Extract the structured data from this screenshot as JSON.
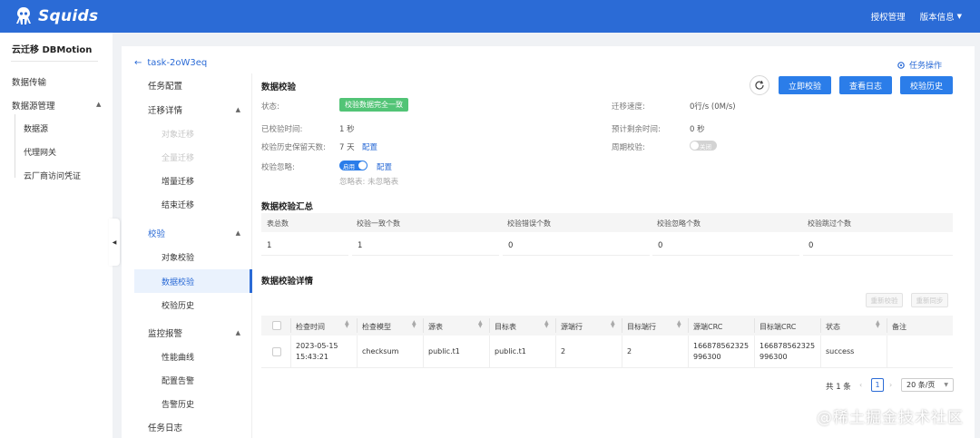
{
  "brand": {
    "name": "Squids",
    "primary": "#2b6bd6"
  },
  "topbar": {
    "links": [
      "授权管理",
      "版本信息"
    ]
  },
  "leftnav": {
    "title": "云迁移 DBMotion",
    "items": [
      "数据传输",
      "数据源管理"
    ],
    "subitems": [
      "数据源",
      "代理网关",
      "云厂商访问凭证"
    ]
  },
  "task": {
    "name": "task-2oW3eq",
    "ops_label": "任务操作"
  },
  "tree": {
    "task_config": "任务配置",
    "migration_details": "迁移详情",
    "object_migration": "对象迁移",
    "full_migration": "全量迁移",
    "incremental_migration": "增量迁移",
    "end_migration": "结束迁移",
    "verify": "校验",
    "object_verify": "对象校验",
    "data_verify": "数据校验",
    "verify_history": "校验历史",
    "monitor_alert": "监控报警",
    "perf_curve": "性能曲线",
    "config_alert": "配置告警",
    "alert_history": "告警历史",
    "task_log": "任务日志"
  },
  "section": {
    "title": "数据校验",
    "buttons": {
      "verify_now": "立即校验",
      "view_logs": "查看日志",
      "verify_history": "校验历史"
    }
  },
  "info": {
    "status_label": "状态:",
    "status_value": "校验数据完全一致",
    "verified_time_label": "已校验时间:",
    "verified_time_value": "1 秒",
    "retention_label": "校验历史保留天数:",
    "retention_value": "7 天",
    "retention_link": "配置",
    "ignore_label": "校验忽略:",
    "ignore_toggle": "启用",
    "ignore_link": "配置",
    "ignore_tables": "忽略表: 未忽略表",
    "speed_label": "迁移速度:",
    "speed_value": "0行/s (0M/s)",
    "remaining_label": "预计剩余时间:",
    "remaining_value": "0 秒",
    "periodic_label": "周期校验:",
    "periodic_toggle": "关闭"
  },
  "summary": {
    "title": "数据校验汇总",
    "headers": [
      "表总数",
      "校验一致个数",
      "校验错误个数",
      "校验忽略个数",
      "校验跳过个数"
    ],
    "values": [
      "1",
      "1",
      "0",
      "0",
      "0"
    ]
  },
  "details": {
    "title": "数据校验详情",
    "action_buttons": [
      "重新校验",
      "重新同步"
    ],
    "headers": [
      "检查时间",
      "检查模型",
      "源表",
      "目标表",
      "源端行",
      "目标端行",
      "源端CRC",
      "目标端CRC",
      "状态",
      "备注"
    ],
    "rows": [
      {
        "time_line1": "2023-05-15",
        "time_line2": "15:43:21",
        "model": "checksum",
        "source_table": "public.t1",
        "target_table": "public.t1",
        "source_rows": "2",
        "target_rows": "2",
        "source_crc_line1": "166878562325",
        "source_crc_line2": "996300",
        "target_crc_line1": "166878562325",
        "target_crc_line2": "996300",
        "status": "success",
        "note": ""
      }
    ]
  },
  "pagination": {
    "total": "共 1 条",
    "page": "1",
    "page_size": "20 条/页"
  },
  "watermark": "@稀土掘金技术社区"
}
